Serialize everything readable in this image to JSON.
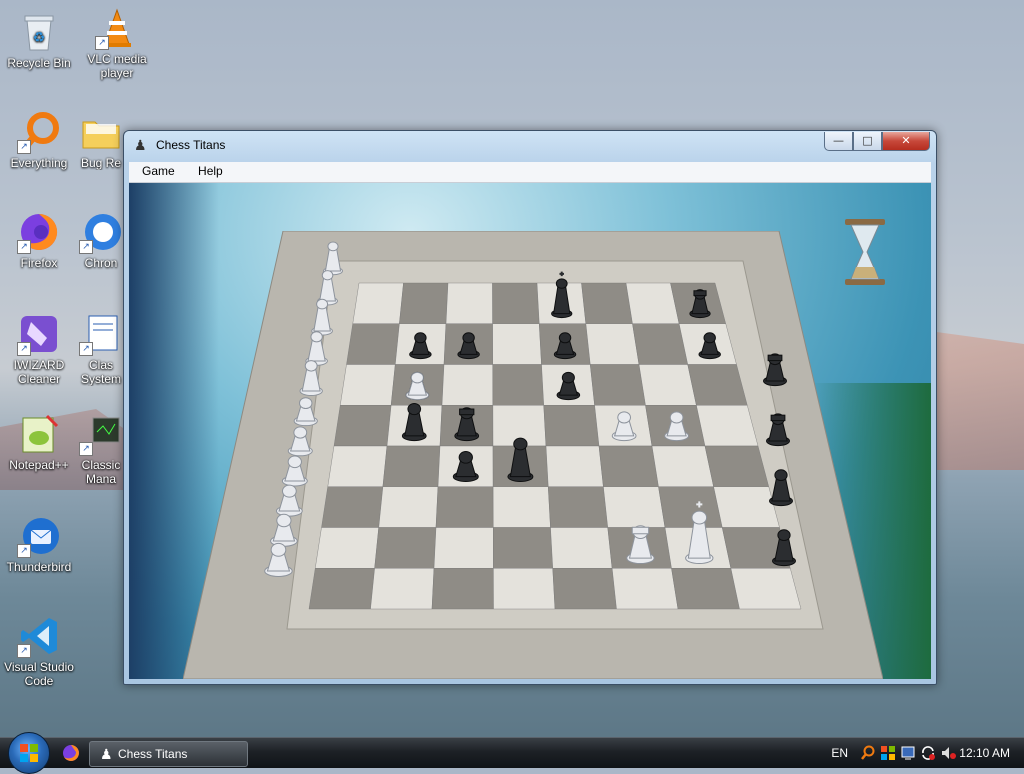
{
  "desktop": {
    "icons": [
      {
        "label": "Recycle Bin"
      },
      {
        "label": "VLC media player"
      },
      {
        "label": "Everything"
      },
      {
        "label": "Bug Re"
      },
      {
        "label": "Firefox"
      },
      {
        "label": "Chron"
      },
      {
        "label": "IWIZARD Cleaner"
      },
      {
        "label": "Clas System"
      },
      {
        "label": "Notepad++"
      },
      {
        "label": "Classic Mana"
      },
      {
        "label": "Thunderbird"
      },
      {
        "label": "Visual Studio Code"
      }
    ]
  },
  "window": {
    "title": "Chess Titans",
    "menus": [
      {
        "label": "Game"
      },
      {
        "label": "Help"
      }
    ],
    "buttons": {
      "minimize": "—",
      "maximize": "□",
      "close": "✕"
    }
  },
  "board": {
    "files": 8,
    "ranks": 8,
    "pieces": [
      {
        "color": "black",
        "type": "king",
        "square": "e8"
      },
      {
        "color": "black",
        "type": "rook",
        "square": "h8"
      },
      {
        "color": "black",
        "type": "pawn",
        "square": "b7"
      },
      {
        "color": "black",
        "type": "pawn",
        "square": "c7"
      },
      {
        "color": "black",
        "type": "pawn",
        "square": "e7"
      },
      {
        "color": "black",
        "type": "pawn",
        "square": "h7"
      },
      {
        "color": "black",
        "type": "pawn",
        "square": "b6"
      },
      {
        "color": "black",
        "type": "pawn",
        "square": "e6"
      },
      {
        "color": "black",
        "type": "bishop",
        "square": "b5"
      },
      {
        "color": "black",
        "type": "rook",
        "square": "c5"
      },
      {
        "color": "black",
        "type": "queen",
        "square": "d4"
      },
      {
        "color": "black",
        "type": "pawn",
        "square": "c4"
      },
      {
        "color": "white",
        "type": "pawn",
        "square": "b6w"
      },
      {
        "color": "white",
        "type": "pawn",
        "square": "f5"
      },
      {
        "color": "white",
        "type": "pawn",
        "square": "g5"
      },
      {
        "color": "white",
        "type": "rook",
        "square": "f2"
      },
      {
        "color": "white",
        "type": "king",
        "square": "g2"
      }
    ],
    "captured_white_count": 11,
    "captured_black_count": 4
  },
  "taskbar": {
    "task_label": "Chess Titans",
    "language": "EN",
    "clock": "12:10 AM"
  },
  "colors": {
    "taskbar": "#1d2126",
    "window_frame": "#b9d2ea",
    "close_button": "#c7483a"
  }
}
